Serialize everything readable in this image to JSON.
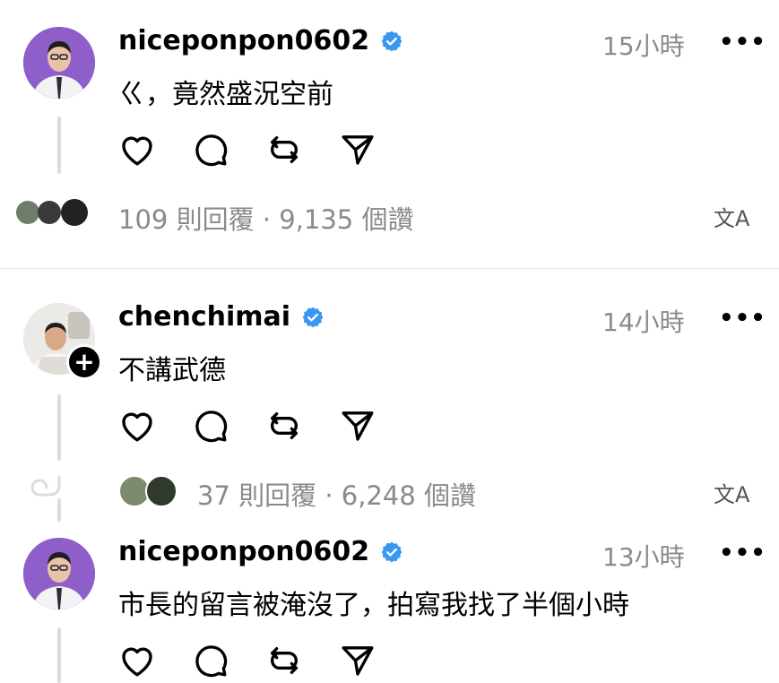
{
  "posts": [
    {
      "username": "niceponpon0602",
      "time": "15小時",
      "more": "•••",
      "text": "ㄍ，竟然盛況空前",
      "stats": "109 則回覆 · 9,135 個讚",
      "translate_icon": "文A"
    },
    {
      "username": "chenchimai",
      "time": "14小時",
      "more": "•••",
      "text": "不講武德",
      "stats": "37 則回覆 · 6,248 個讚",
      "translate_icon": "文A",
      "follow_badge": "+"
    },
    {
      "username": "niceponpon0602",
      "time": "13小時",
      "more": "•••",
      "text": "市長的留言被淹沒了，拍寫我找了半個小時"
    }
  ],
  "colors": {
    "verified": "#3897f0",
    "avatar_purple": "#8e5ec9",
    "secondary_text": "#8a8a8a"
  }
}
